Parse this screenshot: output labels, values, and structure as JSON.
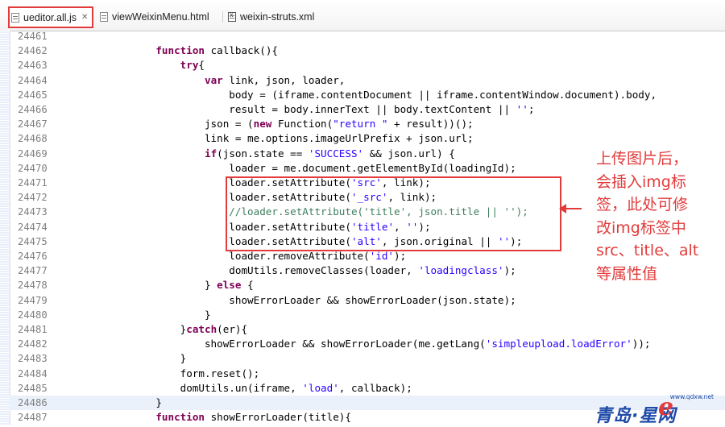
{
  "tabs": [
    {
      "label": "ueditor.all.js",
      "close": "✕"
    },
    {
      "label": "viewWeixinMenu.html"
    },
    {
      "label": "weixin-struts.xml"
    }
  ],
  "lines": [
    {
      "n": "24461",
      "code": [],
      "hl": false
    },
    {
      "n": "24462",
      "code": [
        [
          "",
          "                "
        ],
        [
          "kw",
          "function"
        ],
        [
          "",
          " callback(){"
        ]
      ]
    },
    {
      "n": "24463",
      "code": [
        [
          "",
          "                    "
        ],
        [
          "kw",
          "try"
        ],
        [
          "",
          "{"
        ]
      ]
    },
    {
      "n": "24464",
      "code": [
        [
          "",
          "                        "
        ],
        [
          "kw",
          "var"
        ],
        [
          "",
          " link, json, loader,"
        ]
      ]
    },
    {
      "n": "24465",
      "code": [
        [
          "",
          "                            body = (iframe.contentDocument || iframe.contentWindow.document).body,"
        ]
      ]
    },
    {
      "n": "24466",
      "code": [
        [
          "",
          "                            result = body.innerText || body.textContent || "
        ],
        [
          "str",
          "''"
        ],
        [
          "",
          ";"
        ]
      ]
    },
    {
      "n": "24467",
      "code": [
        [
          "",
          "                        json = ("
        ],
        [
          "kw",
          "new"
        ],
        [
          "",
          " Function("
        ],
        [
          "str",
          "\"return \""
        ],
        [
          "",
          " + result))();"
        ]
      ]
    },
    {
      "n": "24468",
      "code": [
        [
          "",
          "                        link = me.options.imageUrlPrefix + json.url;"
        ]
      ]
    },
    {
      "n": "24469",
      "code": [
        [
          "",
          "                        "
        ],
        [
          "kw",
          "if"
        ],
        [
          "",
          "(json.state == "
        ],
        [
          "str",
          "'SUCCESS'"
        ],
        [
          "",
          " && json.url) {"
        ]
      ]
    },
    {
      "n": "24470",
      "code": [
        [
          "",
          "                            loader = me.document.getElementById(loadingId);"
        ]
      ]
    },
    {
      "n": "24471",
      "code": [
        [
          "",
          "                            loader.setAttribute("
        ],
        [
          "str",
          "'src'"
        ],
        [
          "",
          ", link);"
        ]
      ]
    },
    {
      "n": "24472",
      "code": [
        [
          "",
          "                            loader.setAttribute("
        ],
        [
          "str",
          "'_src'"
        ],
        [
          "",
          ", link);"
        ]
      ]
    },
    {
      "n": "24473",
      "code": [
        [
          "cm",
          "                            //loader.setAttribute('title', json.title || '');"
        ]
      ]
    },
    {
      "n": "24474",
      "code": [
        [
          "",
          "                            loader.setAttribute("
        ],
        [
          "str",
          "'title'"
        ],
        [
          "",
          ", "
        ],
        [
          "str",
          "''"
        ],
        [
          "",
          ");"
        ]
      ]
    },
    {
      "n": "24475",
      "code": [
        [
          "",
          "                            loader.setAttribute("
        ],
        [
          "str",
          "'alt'"
        ],
        [
          "",
          ", json.original || "
        ],
        [
          "str",
          "''"
        ],
        [
          "",
          ");"
        ]
      ]
    },
    {
      "n": "24476",
      "code": [
        [
          "",
          "                            loader.removeAttribute("
        ],
        [
          "str",
          "'id'"
        ],
        [
          "",
          ");"
        ]
      ]
    },
    {
      "n": "24477",
      "code": [
        [
          "",
          "                            domUtils.removeClasses(loader, "
        ],
        [
          "str",
          "'loadingclass'"
        ],
        [
          "",
          ");"
        ]
      ]
    },
    {
      "n": "24478",
      "code": [
        [
          "",
          "                        } "
        ],
        [
          "kw",
          "else"
        ],
        [
          "",
          " {"
        ]
      ]
    },
    {
      "n": "24479",
      "code": [
        [
          "",
          "                            showErrorLoader && showErrorLoader(json.state);"
        ]
      ]
    },
    {
      "n": "24480",
      "code": [
        [
          "",
          "                        }"
        ]
      ]
    },
    {
      "n": "24481",
      "code": [
        [
          "",
          "                    }"
        ],
        [
          "kw",
          "catch"
        ],
        [
          "",
          "(er){"
        ]
      ]
    },
    {
      "n": "24482",
      "code": [
        [
          "",
          "                        showErrorLoader && showErrorLoader(me.getLang("
        ],
        [
          "str",
          "'simpleupload.loadError'"
        ],
        [
          "",
          "));"
        ]
      ]
    },
    {
      "n": "24483",
      "code": [
        [
          "",
          "                    }"
        ]
      ]
    },
    {
      "n": "24484",
      "code": [
        [
          "",
          "                    form.reset();"
        ]
      ]
    },
    {
      "n": "24485",
      "code": [
        [
          "",
          "                    domUtils.un(iframe, "
        ],
        [
          "str",
          "'load'"
        ],
        [
          "",
          ", callback);"
        ]
      ]
    },
    {
      "n": "24486",
      "code": [
        [
          "",
          "                }"
        ]
      ],
      "hl": true
    },
    {
      "n": "24487",
      "code": [
        [
          "",
          "                "
        ],
        [
          "kw",
          "function"
        ],
        [
          "",
          " showErrorLoader(title){"
        ]
      ]
    }
  ],
  "annotation": {
    "text": "上传图片后，\n会插入img标\n签，此处可修\n改img标签中\nsrc、title、alt\n等属性值",
    "color": "#e23b3b"
  },
  "watermark": {
    "url": "www.qdxw.net",
    "name": "青岛·星网",
    "logo_letter": "e"
  },
  "colors": {
    "keyword": "#7f0055",
    "string": "#2a00ff",
    "comment": "#3f7f5f",
    "highlight_box": "#e23b3b"
  }
}
